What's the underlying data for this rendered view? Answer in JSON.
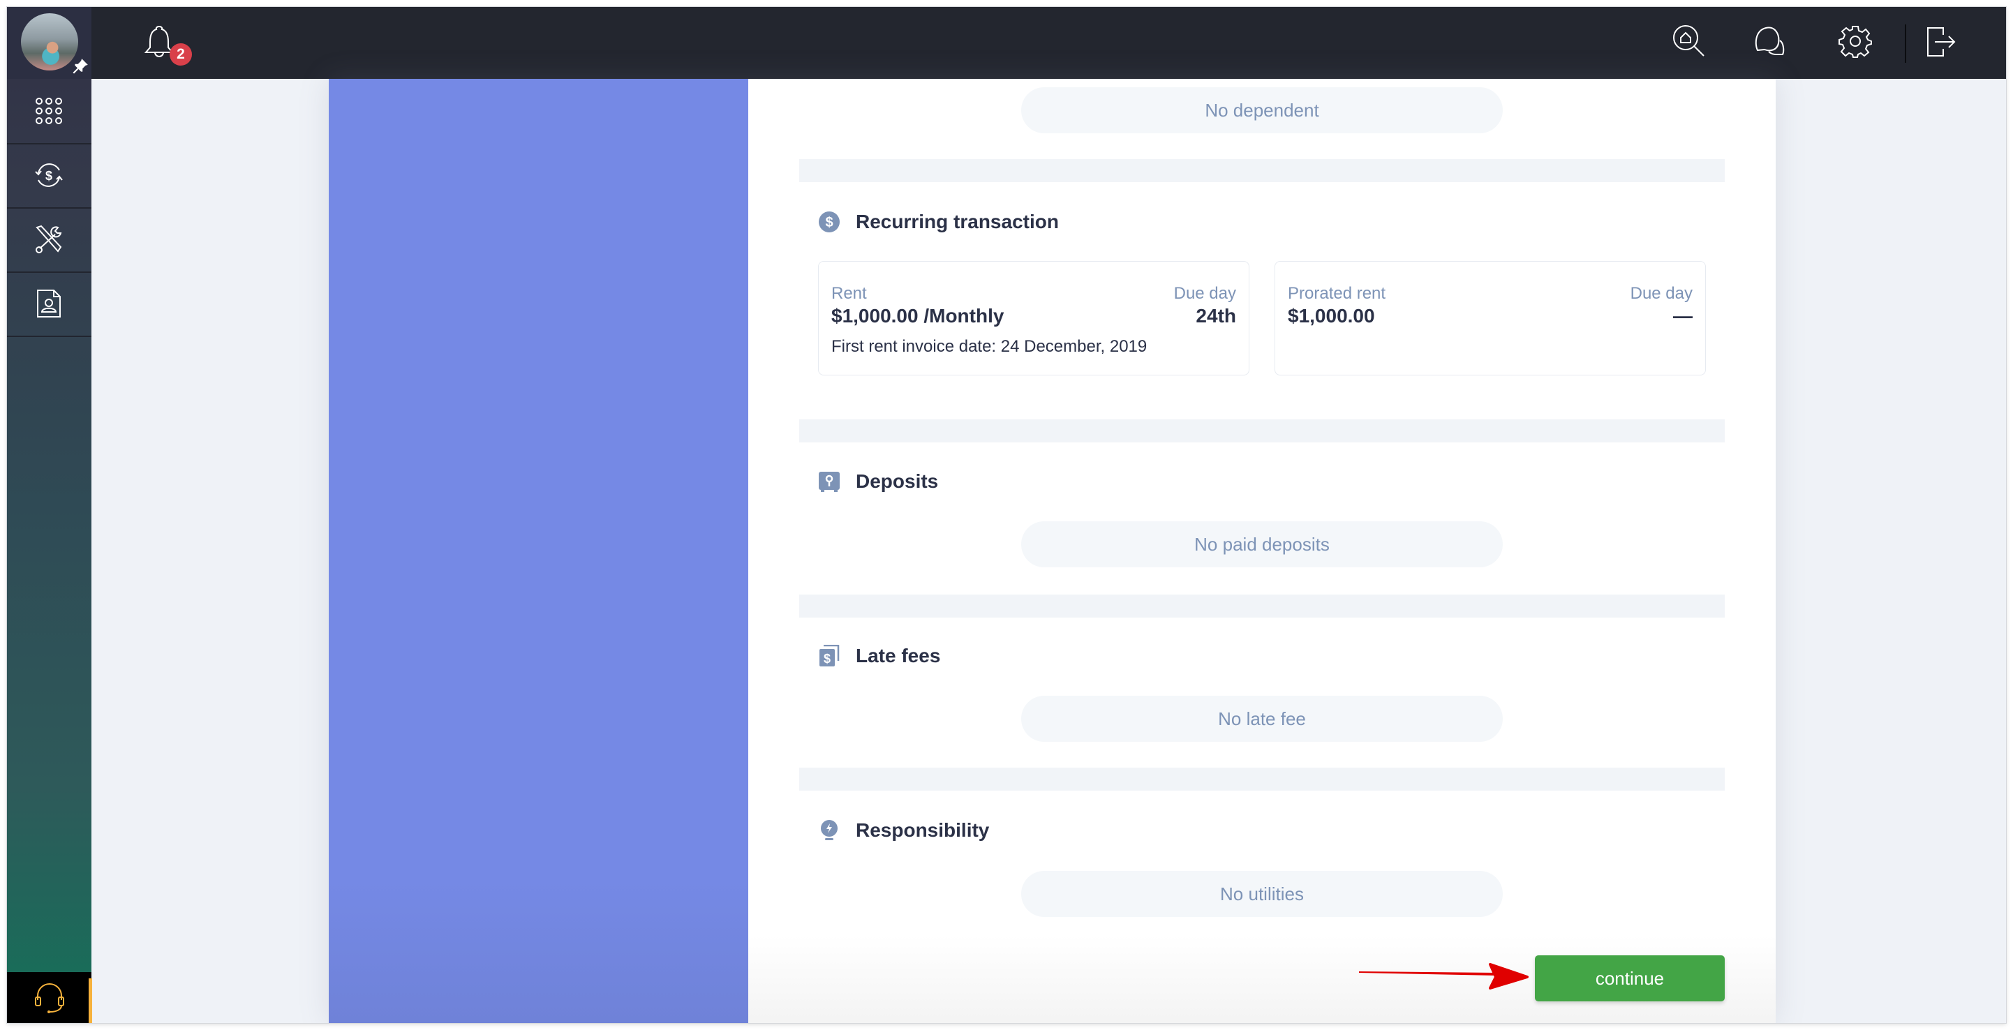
{
  "topbar": {
    "avatar_alt": "User avatar",
    "notification_count": "2",
    "icons": [
      "home-search-icon",
      "chat-icon",
      "gear-icon",
      "logout-icon"
    ]
  },
  "sidebar": {
    "items": [
      {
        "icon": "apps-grid-icon"
      },
      {
        "icon": "recurring-payment-icon"
      },
      {
        "icon": "tools-icon"
      },
      {
        "icon": "contact-document-icon"
      }
    ],
    "support_icon": "headset-icon",
    "accent": "#f6b23c"
  },
  "dependents": {
    "empty_text": "No dependent"
  },
  "recurring": {
    "title": "Recurring transaction",
    "rent": {
      "label": "Rent",
      "amount": "$1,000.00 /Monthly",
      "due_label": "Due day",
      "due_value": "24th",
      "first_invoice": "First rent invoice date: 24 December, 2019"
    },
    "prorated": {
      "label": "Prorated rent",
      "amount": "$1,000.00",
      "due_label": "Due day",
      "due_value": "—"
    }
  },
  "deposits": {
    "title": "Deposits",
    "empty_text": "No paid deposits"
  },
  "late_fees": {
    "title": "Late fees",
    "empty_text": "No late fee"
  },
  "responsibility": {
    "title": "Responsibility",
    "empty_text": "No utilities"
  },
  "actions": {
    "continue_label": "continue"
  },
  "colors": {
    "primary_green": "#43a546",
    "panel_purple": "#7589e5",
    "badge_red": "#d9404a",
    "annotation_arrow": "#e00000"
  }
}
